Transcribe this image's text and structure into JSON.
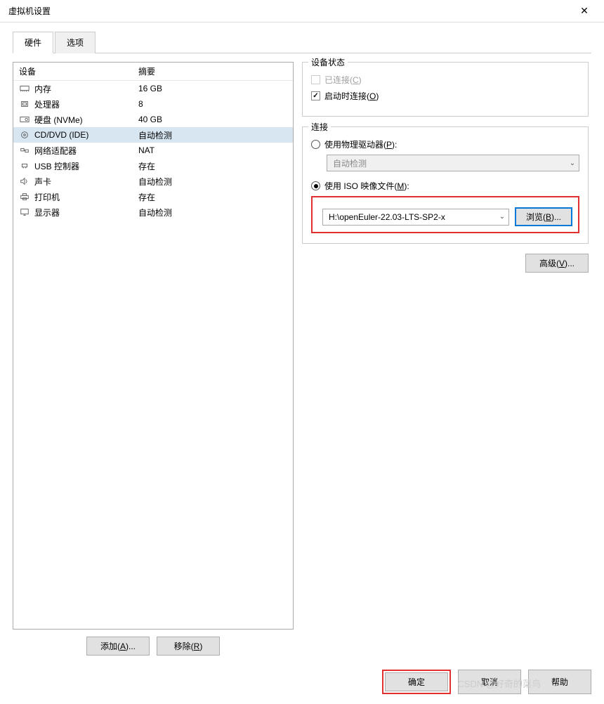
{
  "window": {
    "title": "虚拟机设置",
    "close": "✕"
  },
  "tabs": {
    "hardware": "硬件",
    "options": "选项"
  },
  "device_table": {
    "header_device": "设备",
    "header_summary": "摘要",
    "rows": [
      {
        "icon": "memory",
        "name": "内存",
        "summary": "16 GB"
      },
      {
        "icon": "cpu",
        "name": "处理器",
        "summary": "8"
      },
      {
        "icon": "disk",
        "name": "硬盘 (NVMe)",
        "summary": "40 GB"
      },
      {
        "icon": "cd",
        "name": "CD/DVD (IDE)",
        "summary": "自动检测"
      },
      {
        "icon": "net",
        "name": "网络适配器",
        "summary": "NAT"
      },
      {
        "icon": "usb",
        "name": "USB 控制器",
        "summary": "存在"
      },
      {
        "icon": "sound",
        "name": "声卡",
        "summary": "自动检测"
      },
      {
        "icon": "printer",
        "name": "打印机",
        "summary": "存在"
      },
      {
        "icon": "display",
        "name": "显示器",
        "summary": "自动检测"
      }
    ]
  },
  "left_buttons": {
    "add": "添加(A)...",
    "remove": "移除(R)"
  },
  "device_status": {
    "title": "设备状态",
    "connected": "已连接(C)",
    "connect_on_start": "启动时连接(O)"
  },
  "connection": {
    "title": "连接",
    "physical": "使用物理驱动器(P):",
    "physical_value": "自动检测",
    "iso": "使用 ISO 映像文件(M):",
    "iso_value": "H:\\openEuler-22.03-LTS-SP2-x",
    "browse": "浏览(B)..."
  },
  "advanced": "高级(V)...",
  "buttons": {
    "ok": "确定",
    "cancel": "取消",
    "help": "帮助"
  },
  "watermark": "CSDN @好奇的菜鸟"
}
